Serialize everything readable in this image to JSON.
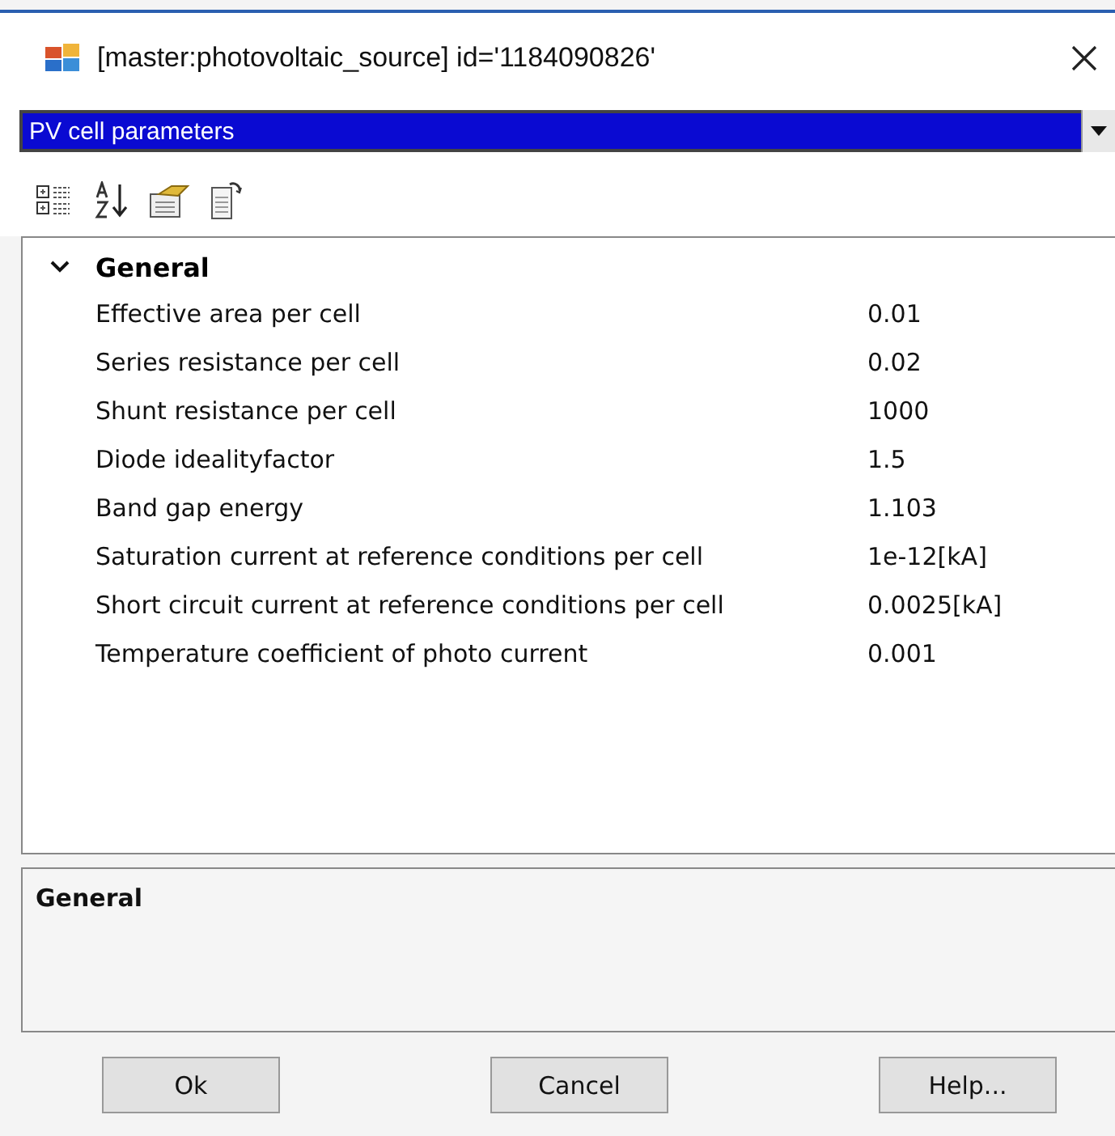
{
  "window": {
    "title": "[master:photovoltaic_source] id='1184090826'"
  },
  "category_dropdown": {
    "value": "PV cell parameters",
    "selected": true
  },
  "property_grid": {
    "categories": [
      {
        "name": "General",
        "expanded": true,
        "properties": [
          {
            "name": "Effective area per cell",
            "value": "0.01"
          },
          {
            "name": "Series resistance per cell",
            "value": "0.02"
          },
          {
            "name": "Shunt resistance per cell",
            "value": "1000"
          },
          {
            "name": "Diode idealityfactor",
            "value": "1.5"
          },
          {
            "name": "Band gap energy",
            "value": "1.103"
          },
          {
            "name": "Saturation current at reference conditions per cell",
            "value": "1e-12[kA]"
          },
          {
            "name": "Short circuit current at reference conditions per cell",
            "value": "0.0025[kA]"
          },
          {
            "name": "Temperature coefficient of photo current",
            "value": "0.001"
          }
        ]
      }
    ]
  },
  "description": {
    "title": "General"
  },
  "buttons": [
    "Ok",
    "Cancel",
    "Help..."
  ]
}
